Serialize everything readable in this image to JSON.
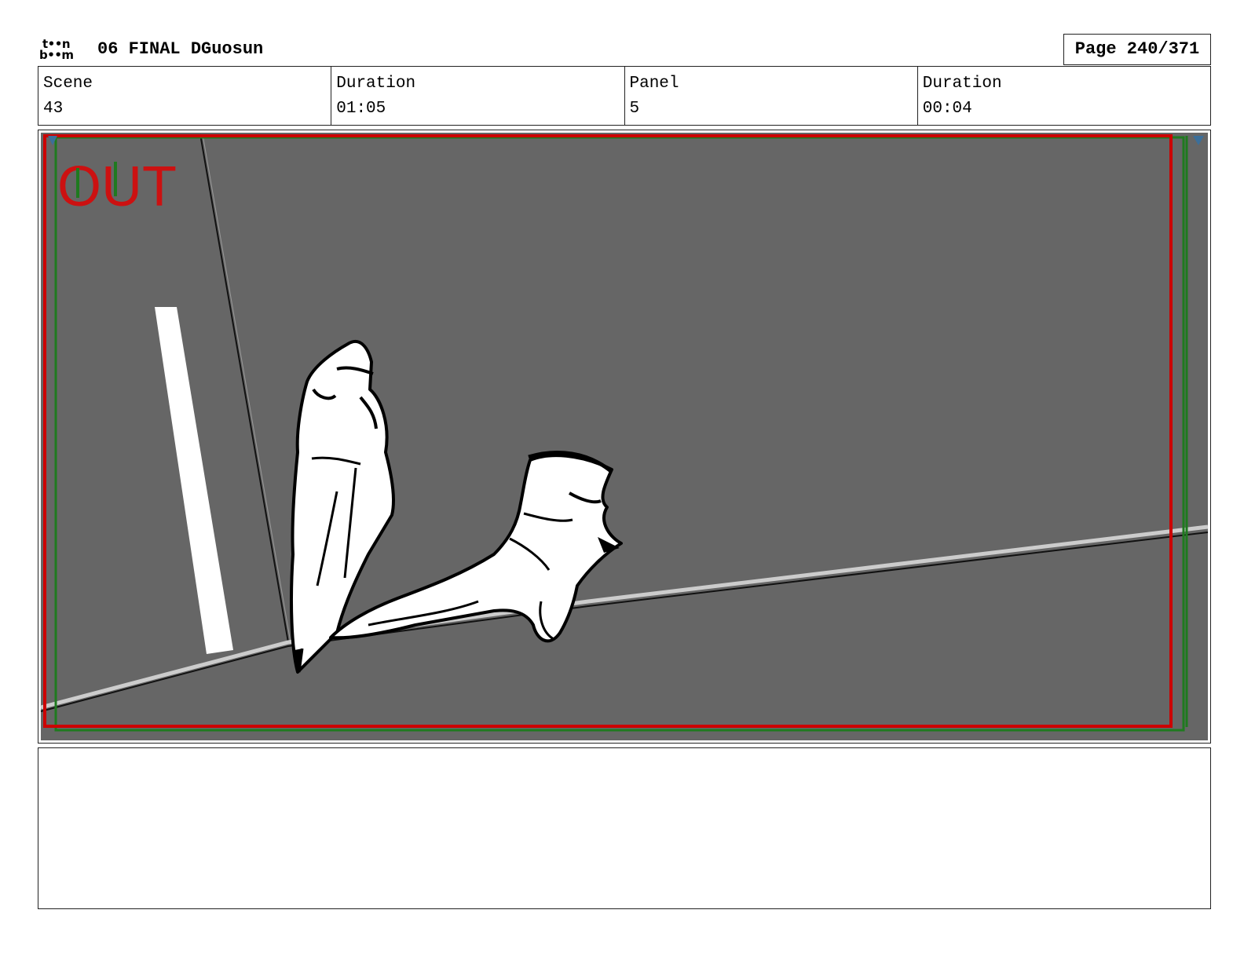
{
  "header": {
    "logo_line1": "t••n",
    "logo_line2": "b••m",
    "title": "06 FINAL DGuosun",
    "page": "Page 240/371"
  },
  "info": {
    "scene_label": "Scene",
    "scene_value": "43",
    "scene_duration_label": "Duration",
    "scene_duration_value": "01:05",
    "panel_label": "Panel",
    "panel_value": "5",
    "panel_duration_label": "Duration",
    "panel_duration_value": "00:04"
  },
  "panel": {
    "overlay_text": "OUT",
    "background_color": "#666666",
    "safe_frame_color": "#cc0000",
    "camera_frame_color": "#1f7a1f"
  },
  "notes": {
    "text": ""
  }
}
